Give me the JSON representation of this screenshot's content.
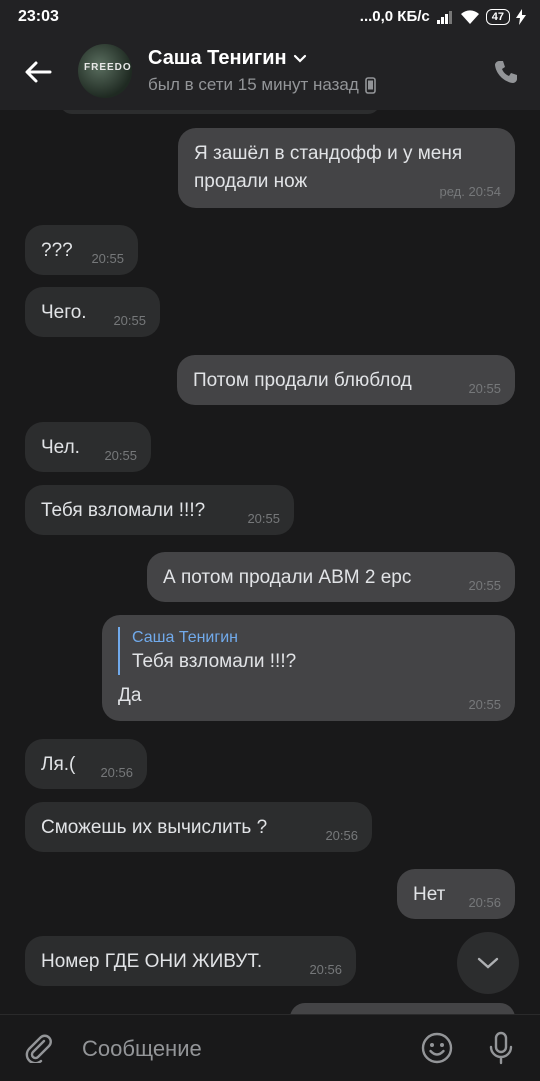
{
  "status_bar": {
    "time": "23:03",
    "network_speed": "...0,0 КБ/с",
    "battery": "47"
  },
  "header": {
    "name": "Саша Тенигин",
    "last_seen": "был в сети 15 минут назад",
    "avatar_text": "FREEDOM"
  },
  "messages": [
    {
      "dir": "out",
      "text": "Я зашёл в стандофф и у меня продали нож",
      "time": "ред. 20:54"
    },
    {
      "dir": "in",
      "text": "???",
      "time": "20:55"
    },
    {
      "dir": "in",
      "text": "Чего.",
      "time": "20:55"
    },
    {
      "dir": "out",
      "text": "Потом продали блюблод",
      "time": "20:55"
    },
    {
      "dir": "in",
      "text": "Чел.",
      "time": "20:55"
    },
    {
      "dir": "in",
      "text": "Тебя взломали !!!?",
      "time": "20:55"
    },
    {
      "dir": "out",
      "text": "А потом продали ABM 2 epc",
      "time": "20:55"
    },
    {
      "dir": "out",
      "reply_author": "Саша Тенигин",
      "reply_text": "Тебя взломали !!!?",
      "text": "Да",
      "time": "20:55"
    },
    {
      "dir": "in",
      "text": "Ля.(",
      "time": "20:56"
    },
    {
      "dir": "in",
      "text": "Сможешь их вычислить ?",
      "time": "20:56"
    },
    {
      "dir": "out",
      "text": "Нет",
      "time": "20:56"
    },
    {
      "dir": "in",
      "text": "Номер ГДЕ ОНИ ЖИВУТ.",
      "time": "20:56"
    }
  ],
  "composer": {
    "placeholder": "Сообщение"
  }
}
